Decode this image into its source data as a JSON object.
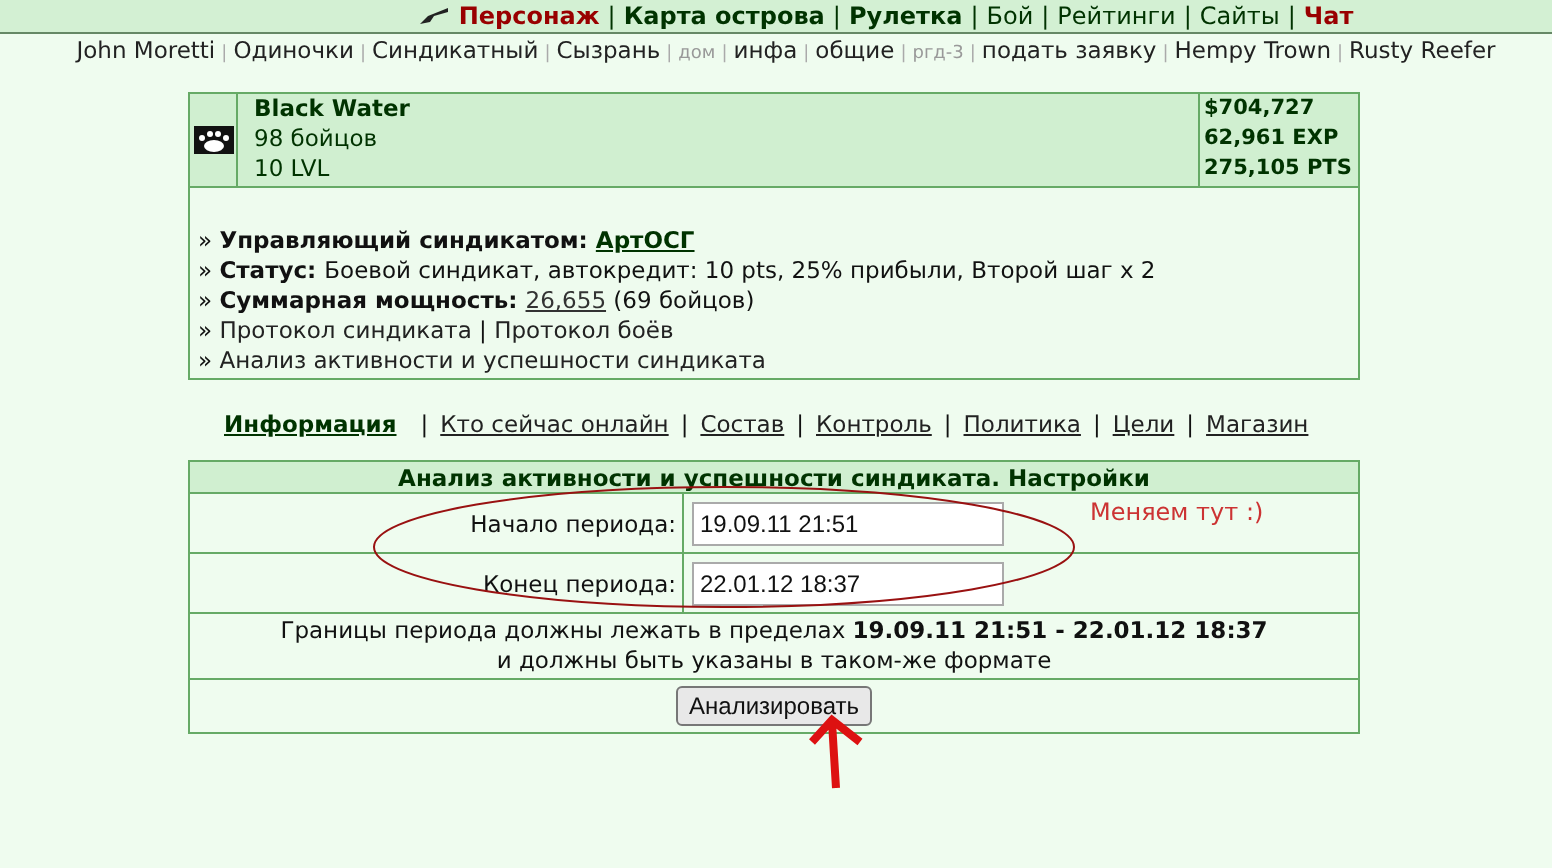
{
  "top_nav": [
    {
      "label": "Персонаж",
      "kind": "red",
      "icon": true
    },
    {
      "sep": "|",
      "label": "Карта острова",
      "kind": "bold"
    },
    {
      "sep": "|",
      "label": "Рулетка",
      "kind": "bold"
    },
    {
      "sep": "|",
      "label": "Бой",
      "kind": "normal"
    },
    {
      "sep": "|",
      "label": "Рейтинги",
      "kind": "normal"
    },
    {
      "sep": "|",
      "label": "Сайты",
      "kind": "normal"
    },
    {
      "sep": "|",
      "label": "Чат",
      "kind": "red"
    }
  ],
  "sub_nav": [
    {
      "label": "John Moretti",
      "kind": "normal"
    },
    {
      "sep": "|",
      "label": "Одиночки",
      "kind": "normal"
    },
    {
      "sep": "|",
      "label": "Синдикатный",
      "kind": "normal"
    },
    {
      "sep": "|",
      "label": "Сызрань",
      "kind": "normal"
    },
    {
      "sep": "|",
      "label": "дом",
      "kind": "small"
    },
    {
      "sep": "|",
      "label": "инфа",
      "kind": "normal"
    },
    {
      "sep": "|",
      "label": "общие",
      "kind": "normal"
    },
    {
      "sep": "|",
      "label": "ргд-3",
      "kind": "small"
    },
    {
      "sep": "|",
      "label": "подать заявку",
      "kind": "normal"
    },
    {
      "sep": "|",
      "label": "Hempy Trown",
      "kind": "normal"
    },
    {
      "sep": "|",
      "label": "Rusty Reefer",
      "kind": "normal"
    }
  ],
  "syndicate": {
    "name": "Black Water",
    "members": "98 бойцов",
    "level": "10 LVL",
    "stats": [
      "$704,727",
      "62,961 EXP",
      "275,105 PTS"
    ],
    "info": [
      {
        "bullet": "»",
        "parts": [
          {
            "kind": "label",
            "text": "Управляющий синдикатом:"
          },
          {
            "kind": "boldlink",
            "text": "АртОСГ"
          }
        ]
      },
      {
        "bullet": "»",
        "parts": [
          {
            "kind": "label",
            "text": "Статус:"
          },
          {
            "kind": "text",
            "text": "Боевой синдикат, автокредит: 10 pts, 25% прибыли, Второй шаг x 2"
          }
        ]
      },
      {
        "bullet": "»",
        "parts": [
          {
            "kind": "label",
            "text": "Суммарная мощность:"
          },
          {
            "kind": "link",
            "text": "26,655"
          },
          {
            "kind": "text",
            "text": "(69 бойцов)"
          }
        ]
      },
      {
        "bullet": "»",
        "parts": [
          {
            "kind": "plainlink",
            "text": "Протокол синдиката"
          },
          {
            "kind": "text",
            "text": "|"
          },
          {
            "kind": "plainlink",
            "text": "Протокол боёв"
          }
        ]
      },
      {
        "bullet": "»",
        "parts": [
          {
            "kind": "plainlink",
            "text": "Анализ активности и успешности синдиката"
          }
        ]
      }
    ]
  },
  "tabs": [
    {
      "label": "Информация",
      "selected": true
    },
    {
      "sep": "|",
      "label": "Кто сейчас онлайн",
      "selected": false
    },
    {
      "sep": "|",
      "label": "Состав",
      "selected": false
    },
    {
      "sep": "|",
      "label": "Контроль",
      "selected": false
    },
    {
      "sep": "|",
      "label": "Политика",
      "selected": false
    },
    {
      "sep": "|",
      "label": "Цели",
      "selected": false
    },
    {
      "sep": "|",
      "label": "Магазин",
      "selected": false
    }
  ],
  "settings": {
    "title": "Анализ активности и успешности синдиката. Настройки",
    "fields": [
      {
        "label": "Начало периода:",
        "value": "19.09.11 21:51"
      },
      {
        "label": "Конец периода:",
        "value": "22.01.12 18:37"
      }
    ],
    "note": "Границы периода должны лежать в пределах **19.09.11 21:51 - 22.01.12 18:37**",
    "note2": "и должны быть указаны в таком-же формате",
    "button": "Анализировать"
  },
  "annotation": {
    "text": "Меняем тут :)"
  }
}
